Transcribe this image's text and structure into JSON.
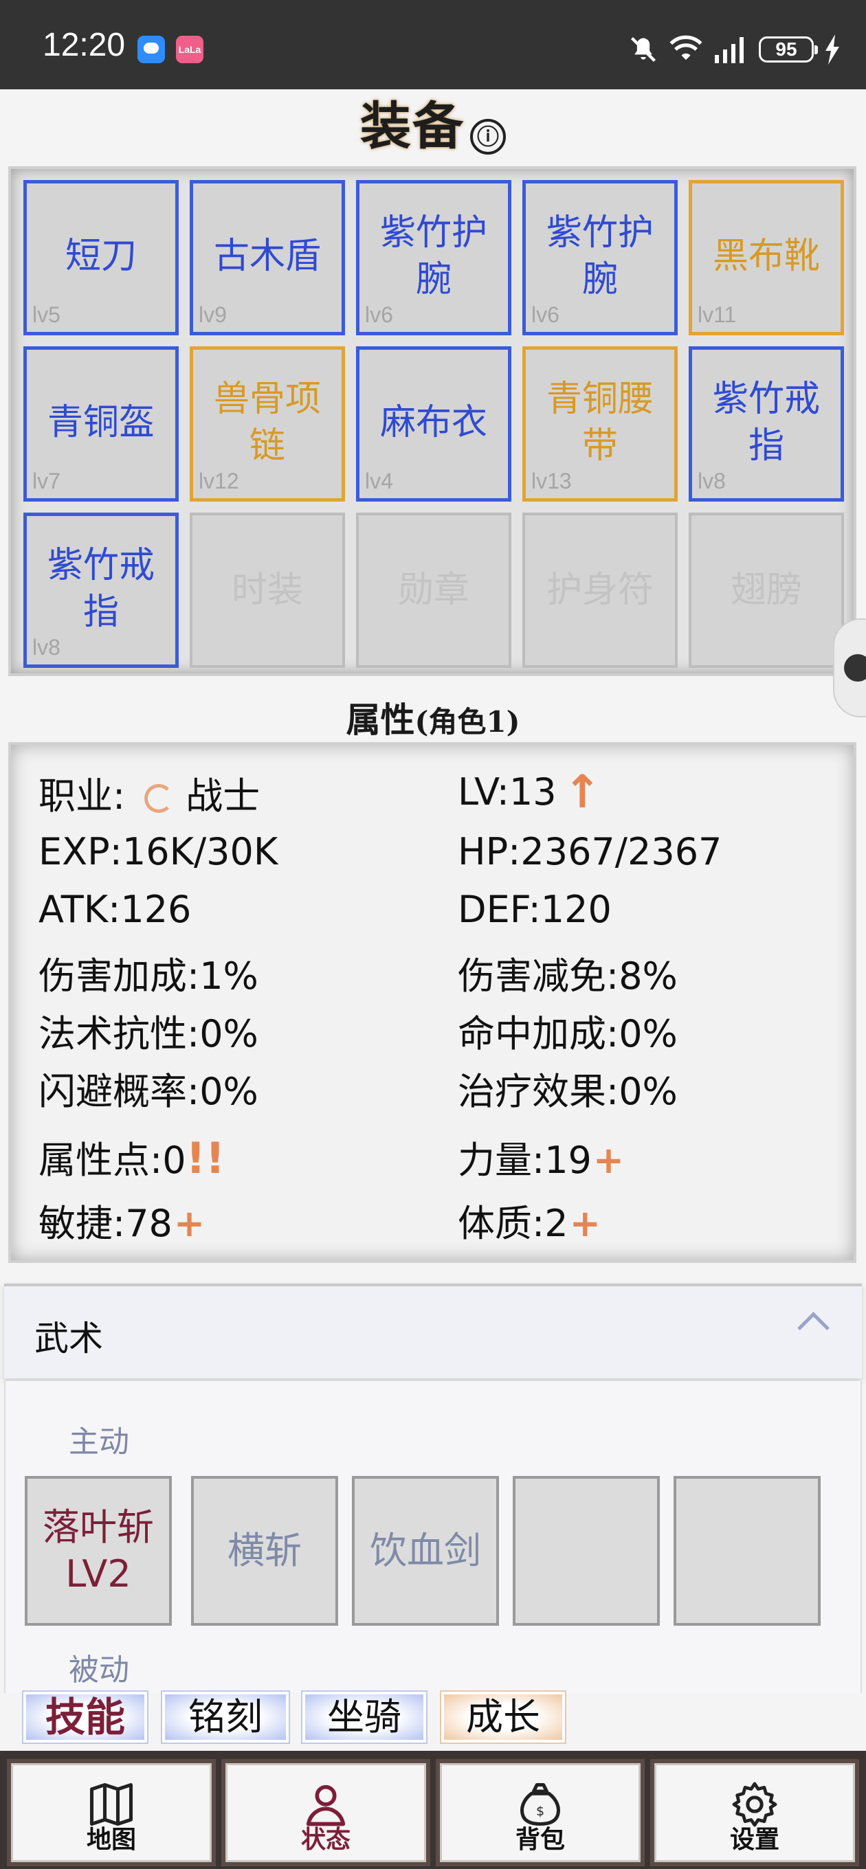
{
  "status_bar": {
    "time": "12:20",
    "app_icon_1": "chat-bubble-icon",
    "app_icon_2": "LaLa",
    "battery": "95",
    "icons": [
      "mute-icon",
      "wifi-icon",
      "signal-icon",
      "battery-icon",
      "charging-icon"
    ]
  },
  "equipment": {
    "title": "装备",
    "info_icon": "ⓘ",
    "slots": [
      {
        "name": "短刀",
        "level": "lv5",
        "rarity": "blue"
      },
      {
        "name": "古木盾",
        "level": "lv9",
        "rarity": "blue"
      },
      {
        "name": "紫竹护腕",
        "level": "lv6",
        "rarity": "blue"
      },
      {
        "name": "紫竹护腕",
        "level": "lv6",
        "rarity": "blue"
      },
      {
        "name": "黑布靴",
        "level": "lv11",
        "rarity": "gold"
      },
      {
        "name": "青铜盔",
        "level": "lv7",
        "rarity": "blue"
      },
      {
        "name": "兽骨项链",
        "level": "lv12",
        "rarity": "gold"
      },
      {
        "name": "麻布衣",
        "level": "lv4",
        "rarity": "blue"
      },
      {
        "name": "青铜腰带",
        "level": "lv13",
        "rarity": "gold"
      },
      {
        "name": "紫竹戒指",
        "level": "lv8",
        "rarity": "blue"
      },
      {
        "name": "紫竹戒指",
        "level": "lv8",
        "rarity": "blue"
      },
      {
        "name": "时装",
        "level": "",
        "rarity": "empty"
      },
      {
        "name": "勋章",
        "level": "",
        "rarity": "empty"
      },
      {
        "name": "护身符",
        "level": "",
        "rarity": "empty"
      },
      {
        "name": "翅膀",
        "level": "",
        "rarity": "empty"
      }
    ]
  },
  "attributes": {
    "title": "属性",
    "subtitle": "(角色1)",
    "job_label": "职业:",
    "job_value": "战士",
    "level": "LV:13",
    "level_up_icon": "↑",
    "exp": "EXP:16K/30K",
    "hp": "HP:2367/2367",
    "atk": "ATK:126",
    "def": "DEF:120",
    "dmg_bonus": "伤害加成:1%",
    "dmg_reduce": "伤害减免:8%",
    "magic_res": "法术抗性:0%",
    "hit_bonus": "命中加成:0%",
    "dodge": "闪避概率:0%",
    "heal": "治疗效果:0%",
    "points": "属性点:0",
    "points_alert": "!!",
    "strength": "力量:19",
    "agility": "敏捷:78",
    "constitution": "体质:2",
    "plus": "+"
  },
  "martial": {
    "title": "武术",
    "active_label": "主动",
    "passive_label": "被动",
    "skills": [
      {
        "name": "落叶斩\nLV2",
        "state": "active"
      },
      {
        "name": "横斩",
        "state": "inactive"
      },
      {
        "name": "饮血剑",
        "state": "inactive"
      },
      {
        "name": "",
        "state": "empty"
      },
      {
        "name": "",
        "state": "empty"
      }
    ]
  },
  "tabs": [
    "技能",
    "铭刻",
    "坐骑",
    "成长"
  ],
  "nav": [
    {
      "label": "地图",
      "icon": "map-icon"
    },
    {
      "label": "状态",
      "icon": "user-icon"
    },
    {
      "label": "背包",
      "icon": "bag-icon"
    },
    {
      "label": "设置",
      "icon": "gear-icon"
    }
  ],
  "colors": {
    "rare_blue": "#3b5bd9",
    "rare_gold": "#e0a534",
    "accent_orange": "#e68552",
    "active_red": "#7c1f39"
  }
}
